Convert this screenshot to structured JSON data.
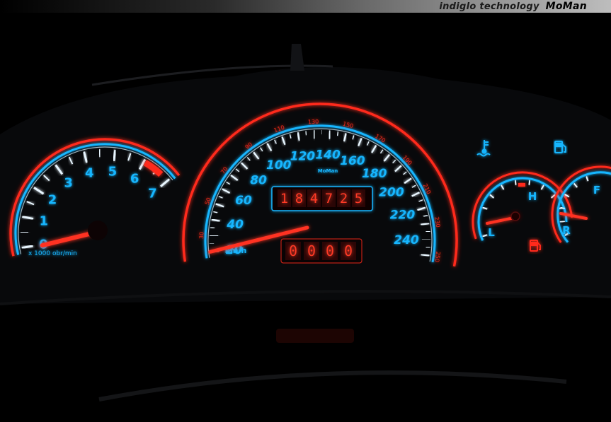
{
  "banner": {
    "caption": "indiglo technology",
    "brand": "MoMan"
  },
  "tachometer": {
    "labels": [
      "0",
      "1",
      "2",
      "3",
      "4",
      "5",
      "6",
      "7"
    ],
    "unit": "x 1000 obr/min",
    "needle_value": 0
  },
  "speedometer": {
    "labels": [
      "20",
      "40",
      "60",
      "80",
      "100",
      "120",
      "140",
      "160",
      "180",
      "200",
      "220",
      "240"
    ],
    "inner_labels": [
      "30",
      "50",
      "70",
      "90",
      "110",
      "130",
      "150",
      "170",
      "190",
      "210",
      "230",
      "250"
    ],
    "unit": "km/h",
    "brand": "MoMan",
    "needle_value": 20
  },
  "odometer": {
    "digits": [
      "1",
      "8",
      "4",
      "7",
      "2",
      "5"
    ]
  },
  "tripmeter": {
    "digits": [
      "0",
      "0",
      "0",
      "0"
    ]
  },
  "temperature_gauge": {
    "high_label": "H",
    "low_label": "L"
  },
  "fuel_gauge": {
    "full_label": "F",
    "reserve_label": "R"
  },
  "colors": {
    "cyan": "#17b6ff",
    "red": "#ff2a1a",
    "ring_white": "#e8f6ff"
  }
}
